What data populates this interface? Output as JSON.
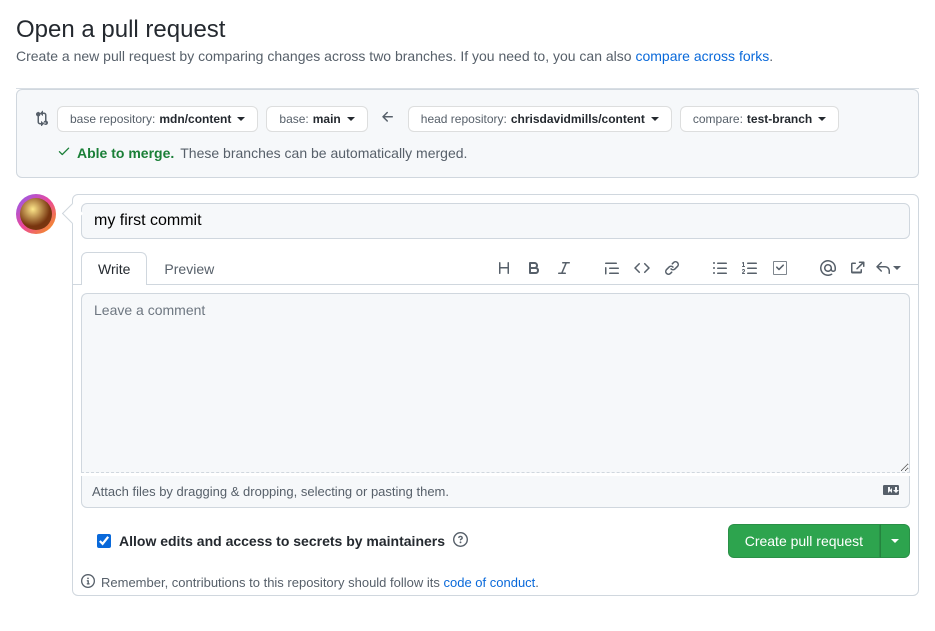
{
  "header": {
    "title": "Open a pull request",
    "subtitle_prefix": "Create a new pull request by comparing changes across two branches. If you need to, you can also ",
    "compare_forks_link": "compare across forks",
    "subtitle_suffix": "."
  },
  "compare": {
    "base_repo_label": "base repository: ",
    "base_repo_value": "mdn/content",
    "base_branch_label": "base: ",
    "base_branch_value": "main",
    "head_repo_label": "head repository: ",
    "head_repo_value": "chrisdavidmills/content",
    "compare_branch_label": "compare: ",
    "compare_branch_value": "test-branch"
  },
  "merge_status": {
    "able_text": "Able to merge.",
    "desc_text": "These branches can be automatically merged."
  },
  "pr": {
    "title_value": "my first commit",
    "comment_placeholder": "Leave a comment",
    "attach_text": "Attach files by dragging & dropping, selecting or pasting them."
  },
  "tabs": {
    "write": "Write",
    "preview": "Preview"
  },
  "footer": {
    "allow_edits_label": "Allow edits and access to secrets by maintainers",
    "create_button": "Create pull request",
    "coc_prefix": "Remember, contributions to this repository should follow its ",
    "coc_link": "code of conduct",
    "coc_suffix": "."
  }
}
